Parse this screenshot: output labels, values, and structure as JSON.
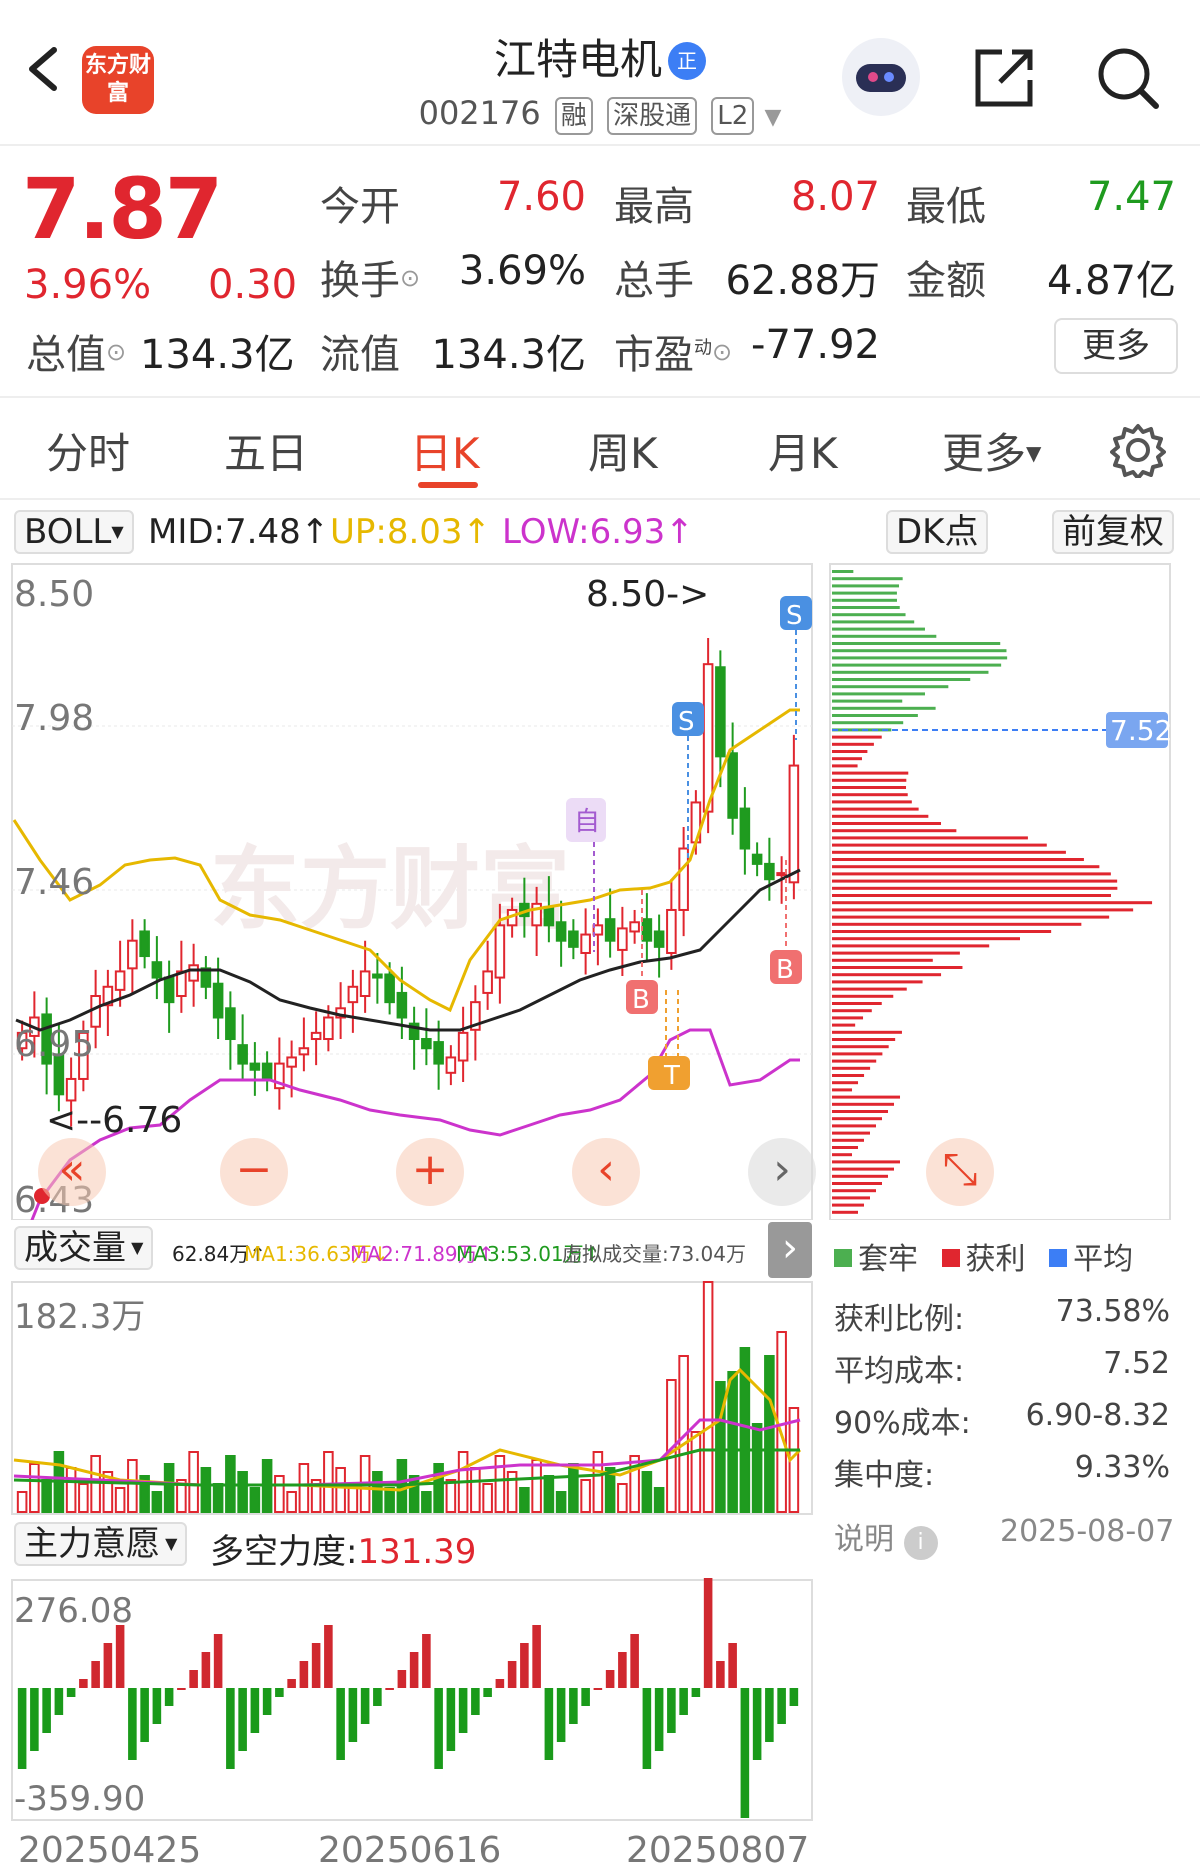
{
  "header": {
    "logo_text": "东方财富",
    "stock_name": "江特电机",
    "badge": "正",
    "stock_code": "002176",
    "tags": [
      "融",
      "深股通",
      "L2"
    ]
  },
  "quote": {
    "price": "7.87",
    "change_pct": "3.96%",
    "change": "0.30",
    "open_label": "今开",
    "open": "7.60",
    "high_label": "最高",
    "high": "8.07",
    "low_label": "最低",
    "low": "7.47",
    "turnover_label": "换手",
    "turnover": "3.69%",
    "volume_label": "总手",
    "volume": "62.88万",
    "amount_label": "金额",
    "amount": "4.87亿",
    "mktcap_label": "总值",
    "mktcap": "134.3亿",
    "float_label": "流值",
    "float": "134.3亿",
    "pe_label": "市盈",
    "pe_super": "动",
    "pe": "-77.92",
    "more_label": "更多"
  },
  "tabs": [
    "分时",
    "五日",
    "日K",
    "周K",
    "月K",
    "更多"
  ],
  "indicator": {
    "name": "BOLL",
    "mid": "MID:7.48↑",
    "up": "UP:8.03↑",
    "low": "LOW:6.93↑",
    "dk_label": "DK点",
    "adjust_label": "前复权",
    "colors": {
      "mid": "#222222",
      "up": "#e6b800",
      "low": "#cc33cc"
    }
  },
  "main_chart": {
    "y_ticks": [
      "8.50",
      "7.98",
      "7.46",
      "6.95",
      "6.43"
    ],
    "high_marker": "8.50->",
    "low_marker": "<--6.76",
    "chip_price": "7.52",
    "signal_self": "自",
    "signal_s": "S",
    "signal_b": "B",
    "signal_t": "T",
    "watermark": "东方财富"
  },
  "volume": {
    "name": "成交量",
    "vol": "62.84万↑",
    "ma1": "MA1:36.63万↓",
    "ma2": "MA2:71.89万↑",
    "ma3": "MA3:53.01万↑",
    "virtual": "虚拟成交量:73.04万",
    "max_label": "182.3万"
  },
  "force": {
    "name": "主力意愿",
    "label": "多空力度:",
    "value": "131.39",
    "max_label": "276.08",
    "min_label": "-359.90"
  },
  "dates": [
    "20250425",
    "20250616",
    "20250807"
  ],
  "chips": {
    "legend": [
      "套牢",
      "获利",
      "平均"
    ],
    "profit_ratio_label": "获利比例:",
    "profit_ratio": "73.58%",
    "avg_cost_label": "平均成本:",
    "avg_cost": "7.52",
    "cost90_label": "90%成本:",
    "cost90": "6.90-8.32",
    "concentration_label": "集中度:",
    "concentration": "9.33%",
    "note_label": "说明",
    "date": "2025-08-07"
  },
  "chart_data": {
    "type": "candlestick",
    "ylim": [
      6.43,
      8.5
    ],
    "series": [
      {
        "name": "K",
        "values": [
          7.0,
          7.05,
          6.9,
          6.8,
          6.85,
          7.0,
          7.12,
          7.15,
          7.2,
          7.3,
          7.25,
          7.18,
          7.1,
          7.2,
          7.22,
          7.15,
          7.05,
          6.98,
          6.9,
          6.88,
          6.85,
          6.9,
          6.92,
          6.95,
          7.0,
          7.05,
          7.08,
          7.15,
          7.2,
          7.18,
          7.1,
          7.05,
          6.98,
          6.95,
          6.9,
          6.92,
          7.0,
          7.1,
          7.2,
          7.35,
          7.4,
          7.38,
          7.42,
          7.35,
          7.3,
          7.28,
          7.32,
          7.35,
          7.3,
          7.34,
          7.36,
          7.3,
          7.28,
          7.4,
          7.6,
          7.75,
          8.2,
          7.9,
          7.7,
          7.6,
          7.55,
          7.5,
          7.52,
          7.87
        ]
      }
    ]
  }
}
